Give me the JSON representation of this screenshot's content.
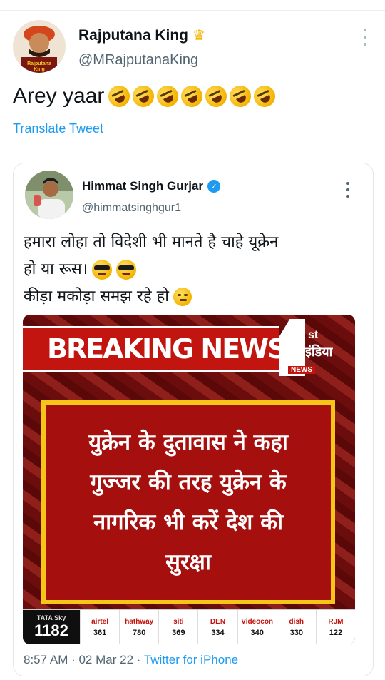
{
  "tweet": {
    "author_name": "Rajputana King",
    "author_handle": "@MRajputanaKing",
    "avatar_text_line1": "Rajputana",
    "avatar_text_line2": "King",
    "text": "Arey yaar",
    "emoji_count": 7,
    "translate_label": "Translate Tweet"
  },
  "quoted_tweet": {
    "author_name": "Himmat Singh Gurjar",
    "author_handle": "@himmatsinghgur1",
    "verified": true,
    "text_line1": "हमारा लोहा तो विदेशी भी मानते है चाहे यूक्रेन",
    "text_line2": "हो या रूस।",
    "text_line3": "कीड़ा मकोड़ा समझ रहे हो",
    "timestamp": "8:57 AM · 02 Mar 22 · ",
    "source": "Twitter for iPhone"
  },
  "news_image": {
    "banner": "BREAKING NEWS",
    "logo_st": "st",
    "logo_india": "इंडिया",
    "logo_news": "NEWS",
    "headline_line1": "युक्रेन के दुतावास ने कहा",
    "headline_line2": "गुज्जर की तरह युक्रेन के",
    "headline_line3": "नागरिक भी करें देश की",
    "headline_line4": "सुरक्षा",
    "tata_label": "TATA Sky",
    "tata_number": "1182",
    "channels": [
      {
        "name": "airtel",
        "number": "361"
      },
      {
        "name": "hathway",
        "number": "780"
      },
      {
        "name": "siti",
        "number": "369"
      },
      {
        "name": "DEN",
        "number": "334"
      },
      {
        "name": "Videocon",
        "number": "340"
      },
      {
        "name": "dish",
        "number": "330"
      },
      {
        "name": "RJM",
        "number": "122"
      }
    ]
  },
  "colors": {
    "link_blue": "#1d9bf0",
    "breaking_red": "#c3150f",
    "headline_border": "#f5c518"
  }
}
